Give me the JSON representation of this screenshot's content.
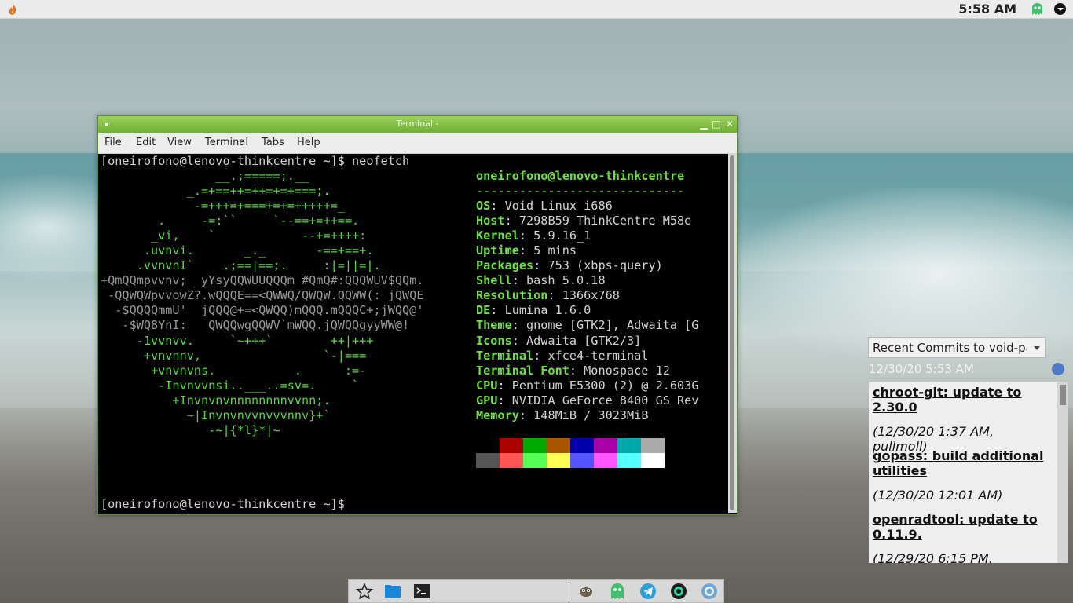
{
  "top_panel": {
    "clock": "5:58 AM",
    "start_icon": "flame-icon",
    "tray_icons": [
      "ghost-tray-icon",
      "system-menu-icon"
    ]
  },
  "terminal": {
    "title": "Terminal -",
    "menu": [
      "File",
      "Edit",
      "View",
      "Terminal",
      "Tabs",
      "Help"
    ],
    "prompt_line": "[oneirofono@lenovo-thinkcentre ~]$ neofetch",
    "final_prompt": "[oneirofono@lenovo-thinkcentre ~]$",
    "ascii_art": [
      "                __.;=====;.__",
      "            _.=+==++=++=+=+===;.",
      "             -=+++=+===+=+=+++++=_",
      "        .     -=:``     `--==+=++==.",
      "       _vi,    `            --+=++++:",
      "      .uvnvi.       _._       -==+==+.",
      "     .vvnvnI`    .;==|==;.     :|=||=|.",
      "+QmQQmpvvnv; _yYsyQQWUUQQQm #QmQ#:QQQWUV$QQm.",
      " -QQWQWpvvowZ?.wQQQE==<QWWQ/QWQW.QQWW(: jQWQE",
      "  -$QQQQmmU'  jQQQ@+=<QWQQ)mQQQ.mQQQC+;jWQQ@'",
      "   -$WQ8YnI:   QWQQwgQQWV`mWQQ.jQWQQgyyWW@!",
      "     -1vvnvv.     `~+++`        ++|+++",
      "      +vnvnnv,                 `-|===",
      "       +vnvnvns.           .      :=-",
      "        -Invnvvnsi..___..=sv=.     `",
      "          +Invnvnvnnnnnnnnvvnn;.",
      "            ~|Invnvnvvnvvvnnv}+`",
      "               -~|{*l}*|~"
    ],
    "neofetch": {
      "user_host": "oneirofono@lenovo-thinkcentre",
      "separator": "-----------------------------",
      "rows": [
        {
          "key": "OS",
          "value": "Void Linux i686"
        },
        {
          "key": "Host",
          "value": "7298B59 ThinkCentre M58e"
        },
        {
          "key": "Kernel",
          "value": "5.9.16_1"
        },
        {
          "key": "Uptime",
          "value": "5 mins"
        },
        {
          "key": "Packages",
          "value": "753 (xbps-query)"
        },
        {
          "key": "Shell",
          "value": "bash 5.0.18"
        },
        {
          "key": "Resolution",
          "value": "1366x768"
        },
        {
          "key": "DE",
          "value": "Lumina 1.6.0"
        },
        {
          "key": "Theme",
          "value": "gnome [GTK2], Adwaita [G"
        },
        {
          "key": "Icons",
          "value": "Adwaita [GTK2/3]"
        },
        {
          "key": "Terminal",
          "value": "xfce4-terminal"
        },
        {
          "key": "Terminal Font",
          "value": "Monospace 12"
        },
        {
          "key": "CPU",
          "value": "Pentium E5300 (2) @ 2.603G"
        },
        {
          "key": "GPU",
          "value": "NVIDIA GeForce 8400 GS Rev"
        },
        {
          "key": "Memory",
          "value": "148MiB / 3023MiB"
        }
      ],
      "palette_top": [
        "#000000",
        "#aa0000",
        "#00aa00",
        "#aa5500",
        "#0000aa",
        "#aa00aa",
        "#00aaaa",
        "#aaaaaa"
      ],
      "palette_bottom": [
        "#555555",
        "#ff5555",
        "#55ff55",
        "#ffff55",
        "#5555ff",
        "#ff55ff",
        "#55ffff",
        "#ffffff"
      ]
    }
  },
  "rss": {
    "feed_selector": "Recent Commits to void-packages:master",
    "updated": "12/30/20 5:53 AM",
    "items": [
      {
        "title": "chroot-git: update to 2.30.0",
        "meta": "(12/30/20 1:37 AM, pullmoll)"
      },
      {
        "title": "gopass: build additional utilities",
        "meta": "(12/30/20 12:01 AM)"
      },
      {
        "title": "openradtool: update to 0.11.9.",
        "meta": "(12/29/20 6:15 PM,"
      }
    ]
  },
  "dock": {
    "icons": [
      "favorites-star-icon",
      "file-manager-icon",
      "terminal-icon",
      "gimp-icon",
      "ghost-app-icon",
      "telegram-icon",
      "camera-app-icon",
      "browser-icon"
    ]
  }
}
